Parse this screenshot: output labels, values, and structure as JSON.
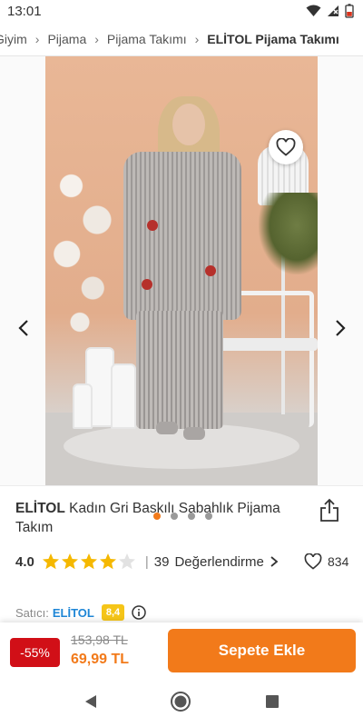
{
  "status_bar": {
    "time": "13:01",
    "icons": [
      "wifi-icon",
      "signal-icon",
      "battery-icon"
    ]
  },
  "breadcrumb": {
    "items": [
      "Giyim",
      "Pijama",
      "Pijama Takımı",
      "ELİTOL Pijama Takımı"
    ]
  },
  "gallery": {
    "image_count": 4,
    "active_index": 0,
    "accent_color": "#f27a1a"
  },
  "product": {
    "brand": "ELİTOL",
    "name": "Kadın Gri Baskılı Sabahlık Pijama Takım"
  },
  "rating": {
    "score": "4.0",
    "stars_filled": 4,
    "stars_total": 5,
    "star_color": "#f5b800",
    "review_count": "39",
    "review_label": "Değerlendirme",
    "favorite_count": "834"
  },
  "seller": {
    "label": "Satıcı:",
    "name": "ELİTOL",
    "score": "8,4"
  },
  "buy_bar": {
    "discount": "-55%",
    "old_price": "153,98 TL",
    "new_price": "69,99 TL",
    "cart_label": "Sepete Ekle",
    "button_color": "#f27a1a",
    "discount_color": "#d10f17"
  },
  "system_nav": {
    "icons": [
      "back-icon",
      "home-icon",
      "recents-icon"
    ]
  }
}
